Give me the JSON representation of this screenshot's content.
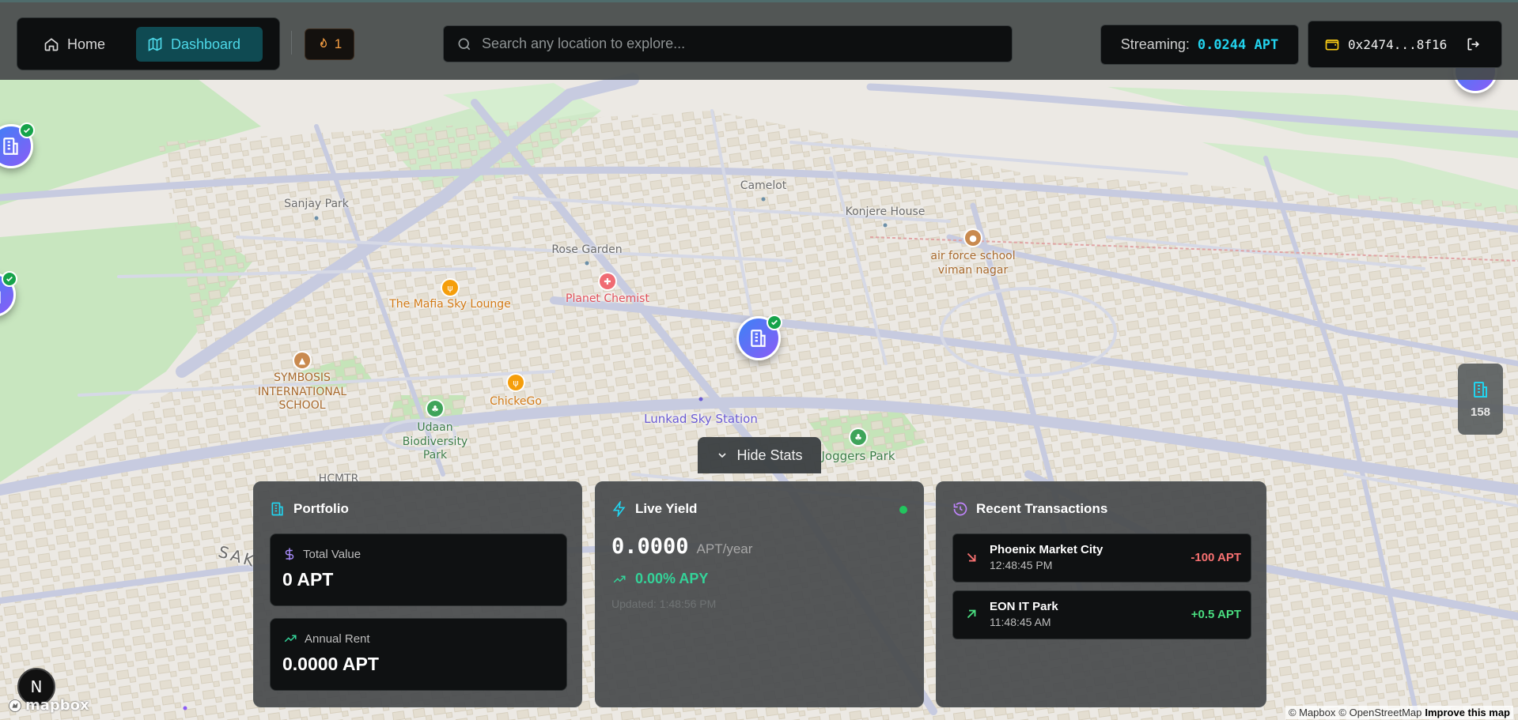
{
  "nav": {
    "home_label": "Home",
    "dashboard_label": "Dashboard",
    "active": "dashboard",
    "streak_count": "1"
  },
  "search": {
    "placeholder": "Search any location to explore...",
    "value": ""
  },
  "streaming": {
    "label": "Streaming:",
    "value": "0.0244 APT"
  },
  "wallet": {
    "address": "0x2474...8f16"
  },
  "map": {
    "labels": [
      {
        "text": "Sanjay Park",
        "style": "gray"
      },
      {
        "text": "Camelot",
        "style": "gray"
      },
      {
        "text": "Konjere House",
        "style": "gray"
      },
      {
        "text": "Rose Garden",
        "style": "gray"
      },
      {
        "text": "air force school\nviman nagar",
        "style": "brown"
      },
      {
        "text": "Planet Chemist",
        "style": "red"
      },
      {
        "text": "The Mafia Sky Lounge",
        "style": "orange"
      },
      {
        "text": "SYMBOSIS\nINTERNATIONAL\nSCHOOL",
        "style": "brown"
      },
      {
        "text": "ChickeGo",
        "style": "orange"
      },
      {
        "text": "Udaan\nBiodiversity\nPark",
        "style": "green"
      },
      {
        "text": "Lunkad Sky Station",
        "style": "purple"
      },
      {
        "text": "Joggers Park",
        "style": "green"
      },
      {
        "text": "HCMTR",
        "style": "gray"
      },
      {
        "text": "SAK",
        "style": "gray"
      }
    ]
  },
  "side_badge": {
    "count": "158"
  },
  "hide_stats_label": "Hide Stats",
  "portfolio": {
    "title": "Portfolio",
    "total_value_label": "Total Value",
    "total_value": "0 APT",
    "annual_rent_label": "Annual Rent",
    "annual_rent": "0.0000 APT"
  },
  "live_yield": {
    "title": "Live Yield",
    "value": "0.0000",
    "unit": "APT/year",
    "apy": "0.00% APY",
    "updated": "Updated: 1:48:56 PM"
  },
  "recent_transactions": {
    "title": "Recent Transactions",
    "items": [
      {
        "name": "Phoenix Market City",
        "time": "12:48:45 PM",
        "amount": "-100 APT",
        "direction": "out"
      },
      {
        "name": "EON IT Park",
        "time": "11:48:45 AM",
        "amount": "+0.5 APT",
        "direction": "in"
      }
    ]
  },
  "footer": {
    "n_badge": "N",
    "mapbox_logo": "mapbox",
    "attribution": [
      "© Mapbox",
      "© OpenStreetMap"
    ],
    "improve_link": "Improve this map"
  },
  "colors": {
    "accent_cyan": "#22d3ee",
    "positive": "#4ade80",
    "negative": "#f87171",
    "marker_gradient_start": "#3b82f6",
    "marker_gradient_end": "#8b5cf6"
  }
}
